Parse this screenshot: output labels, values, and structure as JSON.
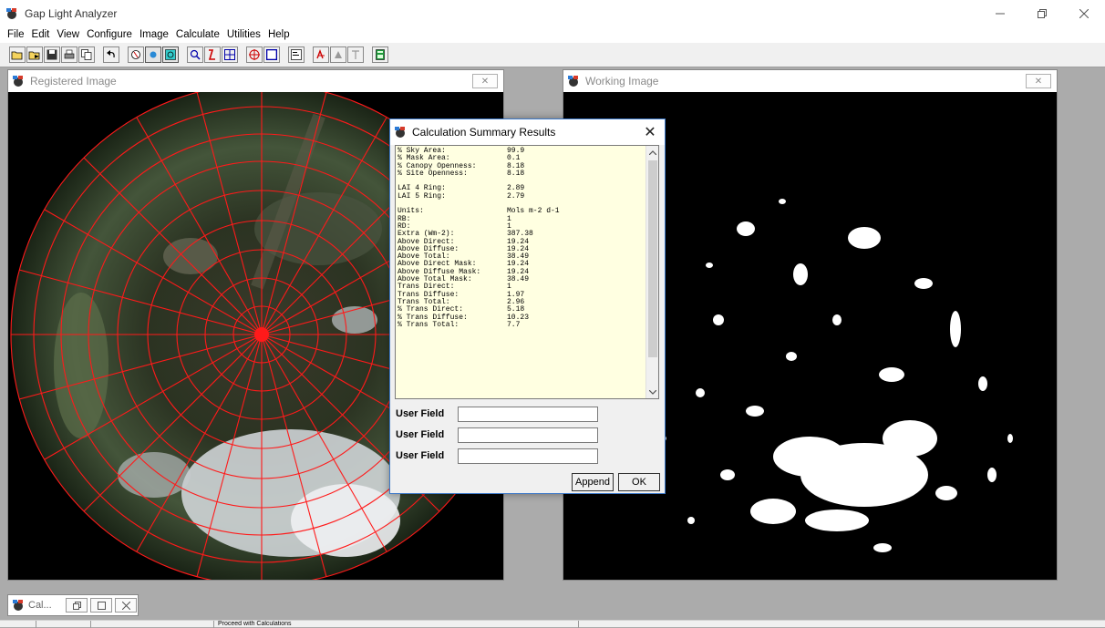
{
  "app": {
    "title": "Gap Light Analyzer",
    "window_controls": [
      "minimize",
      "restore",
      "close"
    ]
  },
  "menu": [
    "File",
    "Edit",
    "View",
    "Configure",
    "Image",
    "Calculate",
    "Utilities",
    "Help"
  ],
  "toolbar_icons": [
    "open-folder-icon",
    "open-image-icon",
    "save-icon",
    "print-icon",
    "copy-icon",
    "undo-icon",
    "hand-icon",
    "circle-icon",
    "register-icon",
    "zoom-icon",
    "threshold-icon",
    "grid-icon",
    "sky-region-icon",
    "fullscreen-icon",
    "properties-icon",
    "run-icon",
    "mask-icon",
    "text-icon",
    "calculator-icon"
  ],
  "windows": {
    "registered": {
      "title": "Registered Image",
      "close": "✕"
    },
    "working": {
      "title": "Working Image",
      "close": "✕"
    }
  },
  "dialog": {
    "title": "Calculation Summary Results",
    "close": "✕",
    "results": [
      {
        "label": "% Sky Area:",
        "value": "99.9"
      },
      {
        "label": "% Mask Area:",
        "value": "0.1"
      },
      {
        "label": "% Canopy Openness:",
        "value": "8.18"
      },
      {
        "label": "% Site Openness:",
        "value": "8.18"
      },
      {
        "label": "",
        "value": ""
      },
      {
        "label": "LAI 4 Ring:",
        "value": "2.89"
      },
      {
        "label": "LAI 5 Ring:",
        "value": "2.79"
      },
      {
        "label": "",
        "value": ""
      },
      {
        "label": "Units:",
        "value": "Mols m-2 d-1"
      },
      {
        "label": "RB:",
        "value": "1"
      },
      {
        "label": "RD:",
        "value": "1"
      },
      {
        "label": "Extra (Wm-2):",
        "value": "387.38"
      },
      {
        "label": "Above Direct:",
        "value": "19.24"
      },
      {
        "label": "Above Diffuse:",
        "value": "19.24"
      },
      {
        "label": "Above Total:",
        "value": "38.49"
      },
      {
        "label": "Above Direct Mask:",
        "value": "19.24"
      },
      {
        "label": "Above Diffuse Mask:",
        "value": "19.24"
      },
      {
        "label": "Above Total Mask:",
        "value": "38.49"
      },
      {
        "label": "Trans Direct:",
        "value": "1"
      },
      {
        "label": "Trans Diffuse:",
        "value": "1.97"
      },
      {
        "label": "Trans Total:",
        "value": "2.96"
      },
      {
        "label": "% Trans Direct:",
        "value": "5.18"
      },
      {
        "label": "% Trans Diffuse:",
        "value": "10.23"
      },
      {
        "label": "% Trans Total:",
        "value": "7.7"
      }
    ],
    "user_fields": [
      {
        "label": "User Field",
        "value": ""
      },
      {
        "label": "User Field",
        "value": ""
      },
      {
        "label": "User Field",
        "value": ""
      }
    ],
    "append_label": "Append",
    "ok_label": "OK"
  },
  "minimized_window": {
    "title": "Cal..."
  },
  "status": {
    "message": "Proceed with Calculations"
  }
}
